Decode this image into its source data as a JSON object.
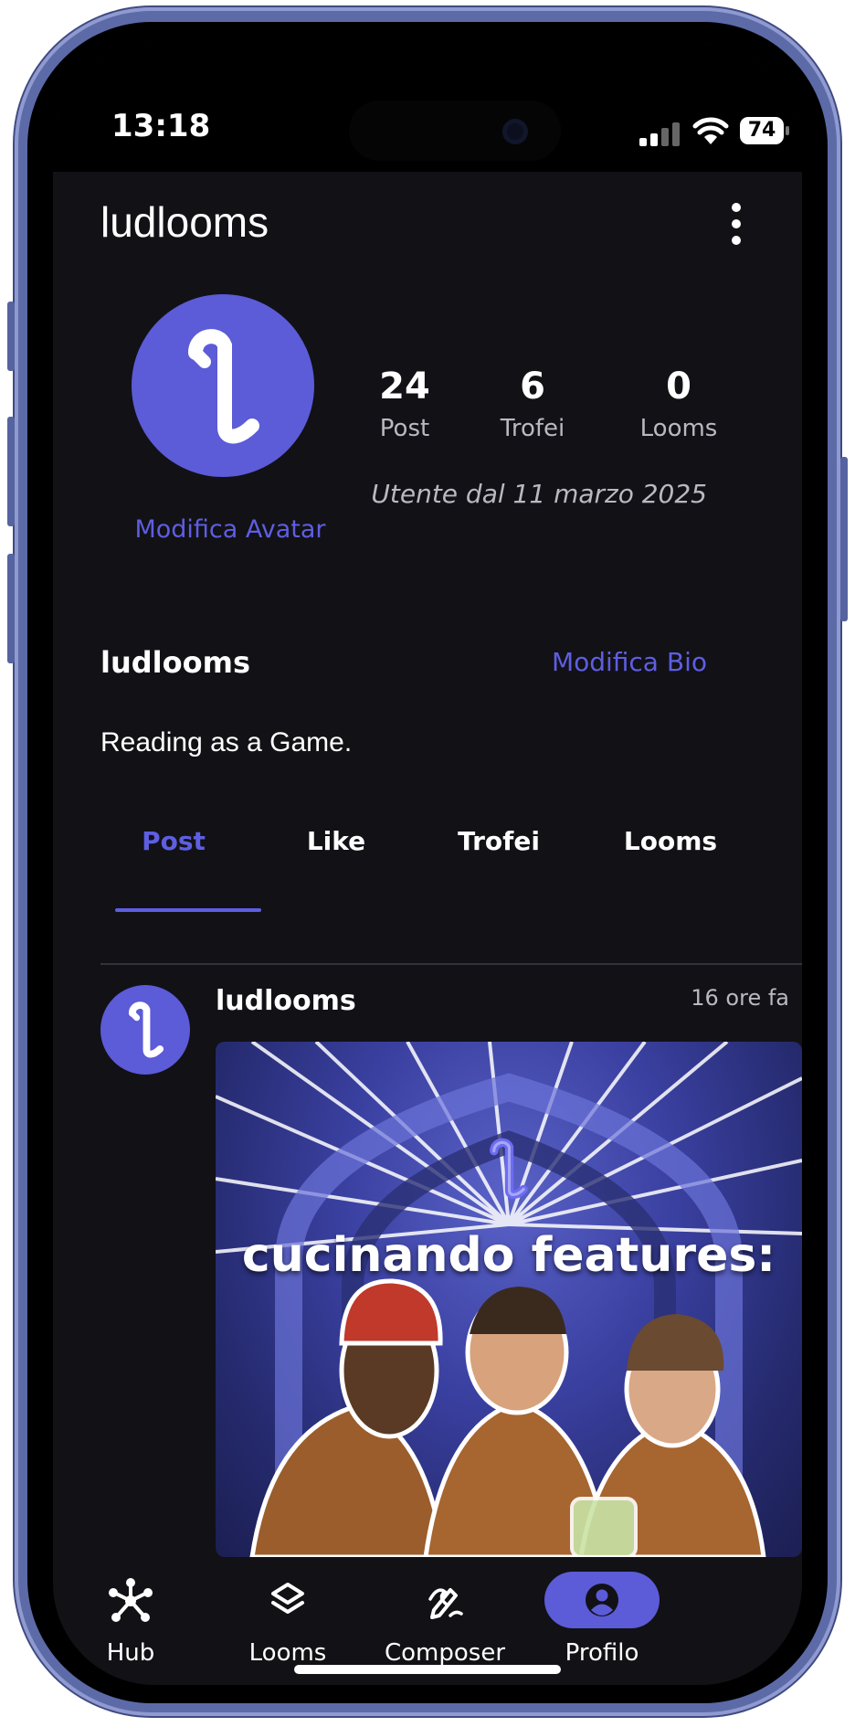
{
  "status_bar": {
    "time": "13:18",
    "battery": "74"
  },
  "header": {
    "title": "ludlooms"
  },
  "profile": {
    "edit_avatar_label": "Modifica Avatar",
    "stats": [
      {
        "value": "24",
        "label": "Post"
      },
      {
        "value": "6",
        "label": "Trofei"
      },
      {
        "value": "0",
        "label": "Looms"
      }
    ],
    "joined": "Utente dal 11 marzo 2025"
  },
  "bio": {
    "name": "ludlooms",
    "edit_label": "Modifica Bio",
    "text": "Reading as a Game."
  },
  "tabs": [
    {
      "label": "Post",
      "active": true
    },
    {
      "label": "Like",
      "active": false
    },
    {
      "label": "Trofei",
      "active": false
    },
    {
      "label": "Looms",
      "active": false
    }
  ],
  "post": {
    "author": "ludlooms",
    "time": "16 ore fa",
    "image_caption": "cucinando features:"
  },
  "bottom_nav": [
    {
      "label": "Hub",
      "icon": "hub-icon",
      "active": false
    },
    {
      "label": "Looms",
      "icon": "layers-icon",
      "active": false
    },
    {
      "label": "Composer",
      "icon": "pen-icon",
      "active": false
    },
    {
      "label": "Profilo",
      "icon": "profile-icon",
      "active": true
    }
  ],
  "colors": {
    "accent": "#5c5bd8",
    "background": "#121116",
    "frame": "#5d6aa8"
  }
}
